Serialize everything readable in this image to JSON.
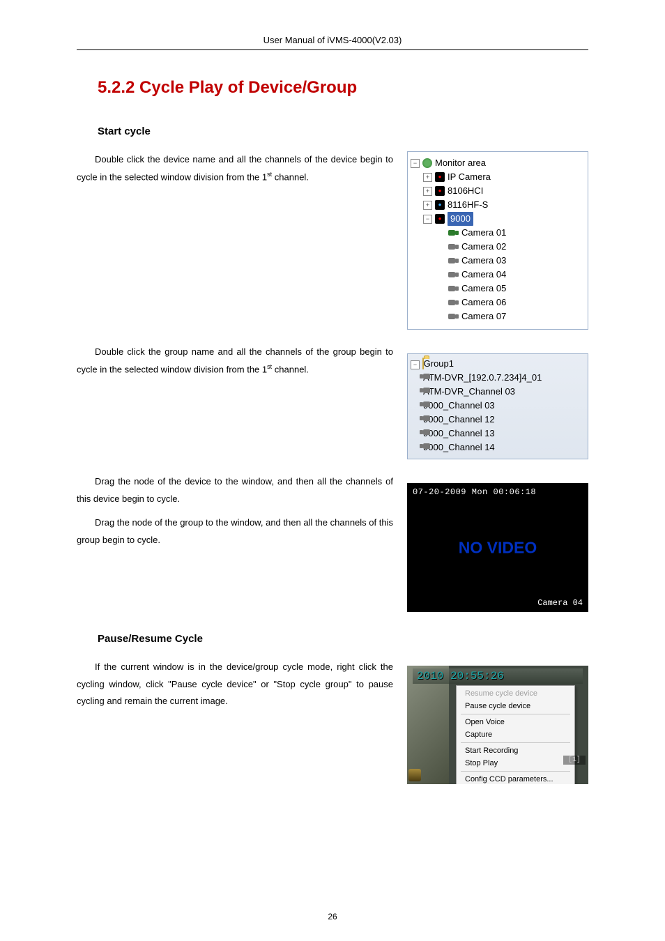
{
  "header": {
    "title": "User Manual of iVMS-4000(V2.03)"
  },
  "section": {
    "heading": "5.2.2 Cycle Play of Device/Group",
    "start_cycle_heading": "Start cycle",
    "para_device_a": "Double click the device name and all the channels of the device begin to cycle in the selected window division from the 1",
    "para_device_suffix": " channel.",
    "para_group_a": "Double click the group name and all the channels of the group begin to cycle in the selected window division from the 1",
    "para_group_suffix": " channel.",
    "para_drag_device": "Drag the node of the device to the window, and then all the channels of this device begin to cycle.",
    "para_drag_group": "Drag the node of the group to the window, and then all the channels of this group begin to cycle.",
    "pause_heading": "Pause/Resume Cycle",
    "para_pause": "If the current window is in the device/group cycle mode, right click the cycling window, click \"Pause cycle device\" or \"Stop cycle group\" to pause cycling and remain the current image.",
    "st_ordinal": "st"
  },
  "tree_monitor": {
    "root": "Monitor area",
    "items": [
      {
        "label": "IP Camera",
        "icon": "dvr"
      },
      {
        "label": "8106HCI",
        "icon": "dvr"
      },
      {
        "label": "8116HF-S",
        "icon": "dvr-blue"
      },
      {
        "label": "9000",
        "icon": "dvr",
        "selected": true,
        "expanded": true
      }
    ],
    "cameras": [
      "Camera 01",
      "Camera 02",
      "Camera 03",
      "Camera 04",
      "Camera 05",
      "Camera 06",
      "Camera 07"
    ]
  },
  "tree_group": {
    "root": "Group1",
    "items": [
      "ATM-DVR_[192.0.7.234]4_01",
      "ATM-DVR_Channel 03",
      "9000_Channel 03",
      "9000_Channel 12",
      "9000_Channel 13",
      "9000_Channel 14"
    ]
  },
  "novideo": {
    "timestamp": "07-20-2009 Mon 00:06:18",
    "text": "NO VIDEO",
    "camera": "Camera 04"
  },
  "context_menu": {
    "timestamp": "2010 20:55:26",
    "items": [
      {
        "label": "Resume cycle device",
        "disabled": true
      },
      {
        "label": "Pause cycle device"
      },
      {
        "label": "Open Voice"
      },
      {
        "label": "Capture"
      },
      {
        "label": "Start Recording"
      },
      {
        "label": "Stop Play"
      },
      {
        "label": "Config CCD parameters..."
      }
    ],
    "right_badge": "[1]"
  },
  "page_number": "26"
}
